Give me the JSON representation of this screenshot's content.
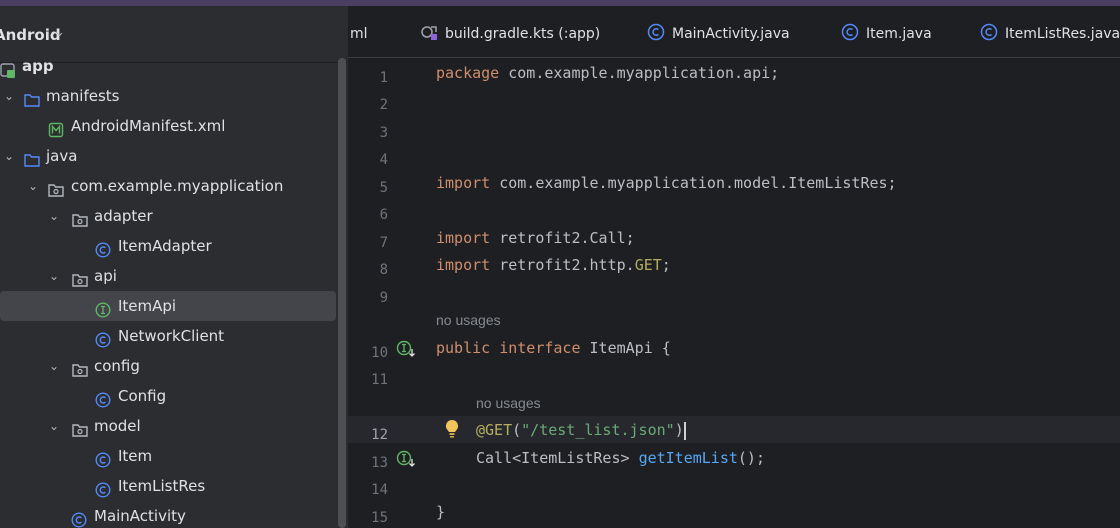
{
  "project_panel": {
    "title": "Android",
    "tree": [
      {
        "label": "app",
        "icon": "app-module-icon",
        "expanded": null
      },
      {
        "label": "manifests",
        "icon": "folder-icon",
        "expanded": true
      },
      {
        "label": "AndroidManifest.xml",
        "icon": "manifest-file-icon",
        "expanded": null
      },
      {
        "label": "java",
        "icon": "folder-icon",
        "expanded": true
      },
      {
        "label": "com.example.myapplication",
        "icon": "package-icon",
        "expanded": true
      },
      {
        "label": "adapter",
        "icon": "package-icon",
        "expanded": true
      },
      {
        "label": "ItemAdapter",
        "icon": "class-icon",
        "expanded": null
      },
      {
        "label": "api",
        "icon": "package-icon",
        "expanded": true
      },
      {
        "label": "ItemApi",
        "icon": "interface-icon",
        "expanded": null,
        "selected": true
      },
      {
        "label": "NetworkClient",
        "icon": "class-icon",
        "expanded": null
      },
      {
        "label": "config",
        "icon": "package-icon",
        "expanded": true
      },
      {
        "label": "Config",
        "icon": "class-icon",
        "expanded": null
      },
      {
        "label": "model",
        "icon": "package-icon",
        "expanded": true
      },
      {
        "label": "Item",
        "icon": "class-icon",
        "expanded": null
      },
      {
        "label": "ItemListRes",
        "icon": "class-icon",
        "expanded": null
      },
      {
        "label": "MainActivity",
        "icon": "class-icon",
        "expanded": null
      }
    ]
  },
  "tabs": [
    {
      "label": "ml",
      "icon": null
    },
    {
      "label": "build.gradle.kts (:app)",
      "icon": "gradle-icon"
    },
    {
      "label": "MainActivity.java",
      "icon": "class-icon"
    },
    {
      "label": "Item.java",
      "icon": "class-icon"
    },
    {
      "label": "ItemListRes.java",
      "icon": "class-icon"
    }
  ],
  "editor": {
    "line_numbers": [
      "1",
      "2",
      "3",
      "4",
      "5",
      "6",
      "7",
      "8",
      "9",
      "10",
      "11",
      "12",
      "13",
      "14",
      "15"
    ],
    "current_line": "12",
    "hints": {
      "before_interface": "no usages",
      "before_method": "no usages"
    },
    "code": {
      "l1_kw": "package",
      "l1_rest": " com.example.myapplication.api;",
      "l5_kw": "import",
      "l5_rest": " com.example.myapplication.model.ItemListRes;",
      "l7_kw": "import",
      "l7_rest": " retrofit2.Call;",
      "l8_kw": "import",
      "l8_rest": " retrofit2.http.",
      "l8_ann": "GET",
      "l8_end": ";",
      "l10_kw1": "public",
      "l10_kw2": "interface",
      "l10_rest": " ItemApi {",
      "l12_ann": "@GET",
      "l12_open": "(",
      "l12_str": "\"/test_list.json\"",
      "l12_close": ")",
      "l13_type": "Call<ItemListRes> ",
      "l13_fn": "getItemList",
      "l13_end": "();",
      "l15": "}"
    }
  },
  "colors": {
    "background": "#1e1f22",
    "panel": "#2b2d30",
    "keyword": "#cf8e6d",
    "string": "#6aab73",
    "annotation": "#b3ae60",
    "function": "#56a8f5",
    "class_icon": "#548af7",
    "interface_icon": "#5fb865"
  }
}
